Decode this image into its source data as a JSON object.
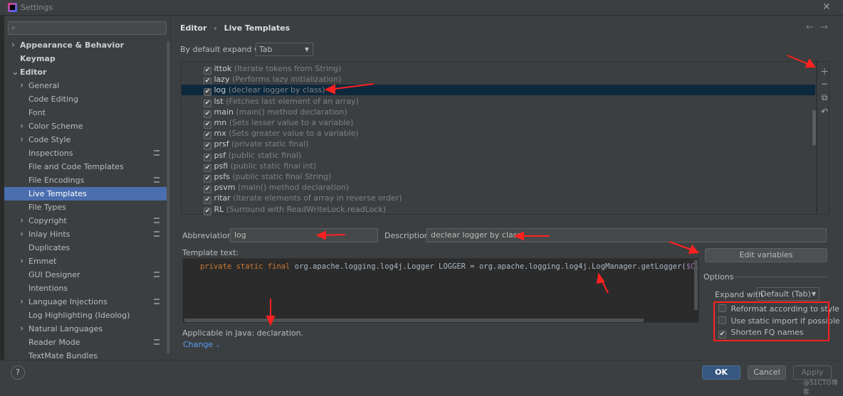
{
  "window": {
    "title": "Settings"
  },
  "search": {
    "placeholder": ""
  },
  "sidebar": {
    "items": [
      {
        "label": "Appearance & Behavior",
        "bold": true,
        "chevron": ">",
        "indent": 0
      },
      {
        "label": "Keymap",
        "bold": true,
        "indent": 0
      },
      {
        "label": "Editor",
        "bold": true,
        "chevron": "v",
        "indent": 0
      },
      {
        "label": "General",
        "chevron": ">",
        "indent": 1
      },
      {
        "label": "Code Editing",
        "indent": 1
      },
      {
        "label": "Font",
        "indent": 1
      },
      {
        "label": "Color Scheme",
        "chevron": ">",
        "indent": 1
      },
      {
        "label": "Code Style",
        "chevron": ">",
        "indent": 1
      },
      {
        "label": "Inspections",
        "indent": 1,
        "badge": true
      },
      {
        "label": "File and Code Templates",
        "indent": 1
      },
      {
        "label": "File Encodings",
        "indent": 1,
        "badge": true
      },
      {
        "label": "Live Templates",
        "indent": 1,
        "selected": true
      },
      {
        "label": "File Types",
        "indent": 1
      },
      {
        "label": "Copyright",
        "chevron": ">",
        "indent": 1,
        "badge": true
      },
      {
        "label": "Inlay Hints",
        "chevron": ">",
        "indent": 1,
        "badge": true
      },
      {
        "label": "Duplicates",
        "indent": 1
      },
      {
        "label": "Emmet",
        "chevron": ">",
        "indent": 1
      },
      {
        "label": "GUI Designer",
        "indent": 1,
        "badge": true
      },
      {
        "label": "Intentions",
        "indent": 1
      },
      {
        "label": "Language Injections",
        "chevron": ">",
        "indent": 1,
        "badge": true
      },
      {
        "label": "Log Highlighting (Ideolog)",
        "indent": 1
      },
      {
        "label": "Natural Languages",
        "chevron": ">",
        "indent": 1
      },
      {
        "label": "Reader Mode",
        "indent": 1,
        "badge": true
      },
      {
        "label": "TextMate Bundles",
        "indent": 1
      }
    ]
  },
  "breadcrumb": {
    "parent": "Editor",
    "separator": "›",
    "current": "Live Templates"
  },
  "expand": {
    "label": "By default expand with",
    "value": "Tab"
  },
  "templates": [
    {
      "abbr": "ittok",
      "desc": "(Iterate tokens from String)",
      "checked": true
    },
    {
      "abbr": "lazy",
      "desc": "(Performs lazy initialization)",
      "checked": true
    },
    {
      "abbr": "log",
      "desc": "(declear logger by class)",
      "checked": true,
      "selected": true
    },
    {
      "abbr": "lst",
      "desc": "(Fetches last element of an array)",
      "checked": true
    },
    {
      "abbr": "main",
      "desc": "(main() method declaration)",
      "checked": true
    },
    {
      "abbr": "mn",
      "desc": "(Sets lesser value to a variable)",
      "checked": true
    },
    {
      "abbr": "mx",
      "desc": "(Sets greater value to a variable)",
      "checked": true
    },
    {
      "abbr": "prsf",
      "desc": "(private static final)",
      "checked": true
    },
    {
      "abbr": "psf",
      "desc": "(public static final)",
      "checked": true
    },
    {
      "abbr": "psfi",
      "desc": "(public static final int)",
      "checked": true
    },
    {
      "abbr": "psfs",
      "desc": "(public static final String)",
      "checked": true
    },
    {
      "abbr": "psvm",
      "desc": "(main() method declaration)",
      "checked": true
    },
    {
      "abbr": "ritar",
      "desc": "(Iterate elements of array in reverse order)",
      "checked": true
    },
    {
      "abbr": "RL",
      "desc": "(Surround with ReadWriteLock.readLock)",
      "checked": true
    }
  ],
  "form": {
    "abbreviation_label": "Abbreviation:",
    "abbreviation": "log",
    "description_label": "Description:",
    "description": "declear logger by class",
    "template_text_label": "Template text:",
    "template_kw": "private static final",
    "template_code": " org.apache.logging.log4j.Logger LOGGER = org.apache.logging.log4j.LogManager.getLogger(",
    "template_var": "$CLASS$",
    "applicable": "Applicable in Java: declaration.",
    "change": "Change"
  },
  "edit_variables": "Edit variables",
  "options": {
    "title": "Options",
    "expand_label": "Expand with",
    "expand_value": "Default (Tab)",
    "items": [
      {
        "label": "Reformat according to style",
        "checked": false
      },
      {
        "label": "Use static import if possible",
        "checked": false
      },
      {
        "label": "Shorten FQ names",
        "checked": true
      }
    ]
  },
  "buttons": {
    "ok": "OK",
    "cancel": "Cancel",
    "apply": "Apply",
    "help": "?"
  },
  "watermark": "@51CTO博客",
  "colors": {
    "selection": "#4b6eaf",
    "accent_ok": "#365880",
    "annotation": "#ff2020",
    "keyword": "#cc7832",
    "variable": "#9876aa",
    "link": "#589df6"
  }
}
